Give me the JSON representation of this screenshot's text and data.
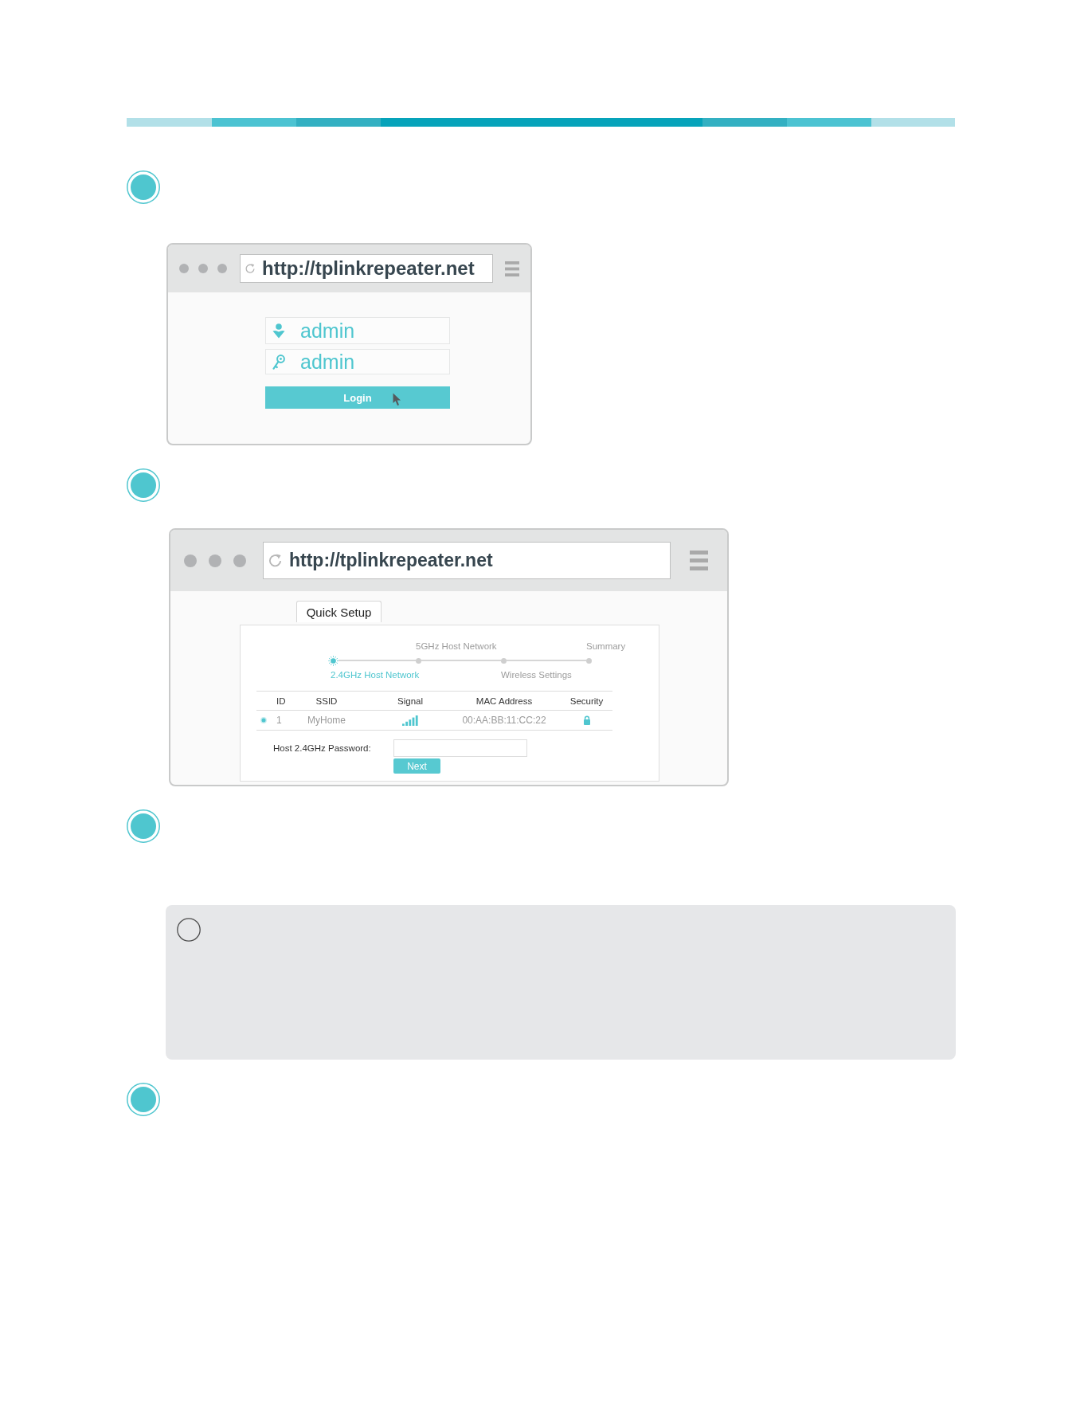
{
  "steps": [
    {
      "kind": "login",
      "browser": {
        "url": "http://tplinkrepeater.net",
        "username": "admin",
        "password": "admin",
        "login_button": "Login"
      }
    },
    {
      "kind": "quick_setup",
      "browser": {
        "url": "http://tplinkrepeater.net",
        "tab": "Quick Setup",
        "wizard": [
          {
            "label": "2.4GHz Host Network",
            "selected": true
          },
          {
            "label": "5GHz Host Network",
            "selected": false
          },
          {
            "label": "Wireless Settings",
            "selected": false
          },
          {
            "label": "Summary",
            "selected": false
          }
        ],
        "table": {
          "columns": [
            "ID",
            "SSID",
            "Signal",
            "MAC Address",
            "Security"
          ],
          "rows": [
            {
              "selected": true,
              "id": "1",
              "ssid": "MyHome",
              "mac_address": "00:AA:BB:11:CC:22",
              "secured": true
            }
          ]
        },
        "password_label": "Host 2.4GHz Password:",
        "next_button": "Next"
      }
    },
    {
      "kind": "note"
    },
    {
      "kind": "plain"
    }
  ]
}
